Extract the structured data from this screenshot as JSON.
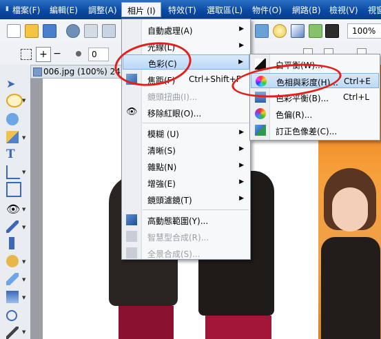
{
  "menubar": {
    "items": [
      "檔案(F)",
      "編輯(E)",
      "調整(A)",
      "相片 (I)",
      "特效(T)",
      "選取區(L)",
      "物件(O)",
      "網路(B)",
      "檢視(V)",
      "視窗"
    ]
  },
  "toolbar": {
    "zoom": "100%"
  },
  "optionbar": {
    "field_value": "0"
  },
  "document": {
    "tab_title": "006.jpg (100%) 24"
  },
  "photo_menu": {
    "items": [
      {
        "label": "自動處理(A)",
        "submenu": true
      },
      {
        "label": "光線(L)",
        "submenu": true
      },
      {
        "label": "色彩(C)",
        "submenu": true
      },
      {
        "label": "焦距(F)",
        "shortcut": "Ctrl+Shift+F"
      },
      {
        "label": "鏡頭扭曲(I)..."
      },
      {
        "label": "移除紅眼(O)..."
      },
      {
        "label": "模糊 (U)",
        "submenu": true
      },
      {
        "label": "清晰(S)",
        "submenu": true
      },
      {
        "label": "雜點(N)",
        "submenu": true
      },
      {
        "label": "增強(E)",
        "submenu": true
      },
      {
        "label": "鏡頭濾鏡(T)",
        "submenu": true
      },
      {
        "label": "高動態範圍(Y)..."
      },
      {
        "label": "智慧型合成(R)..."
      },
      {
        "label": "全景合成(S)..."
      }
    ]
  },
  "color_submenu": {
    "items": [
      {
        "label": "白平衡(W)..."
      },
      {
        "label": "色相與彩度(H)...",
        "shortcut": "Ctrl+E"
      },
      {
        "label": "色彩平衡(B)...",
        "shortcut": "Ctrl+L"
      },
      {
        "label": "色偏(R)..."
      },
      {
        "label": "訂正色像差(C)..."
      }
    ]
  },
  "colors": {
    "menubar": "#0b4aa4",
    "highlight": "#bcd9f6",
    "annotation": "#e0201c"
  }
}
